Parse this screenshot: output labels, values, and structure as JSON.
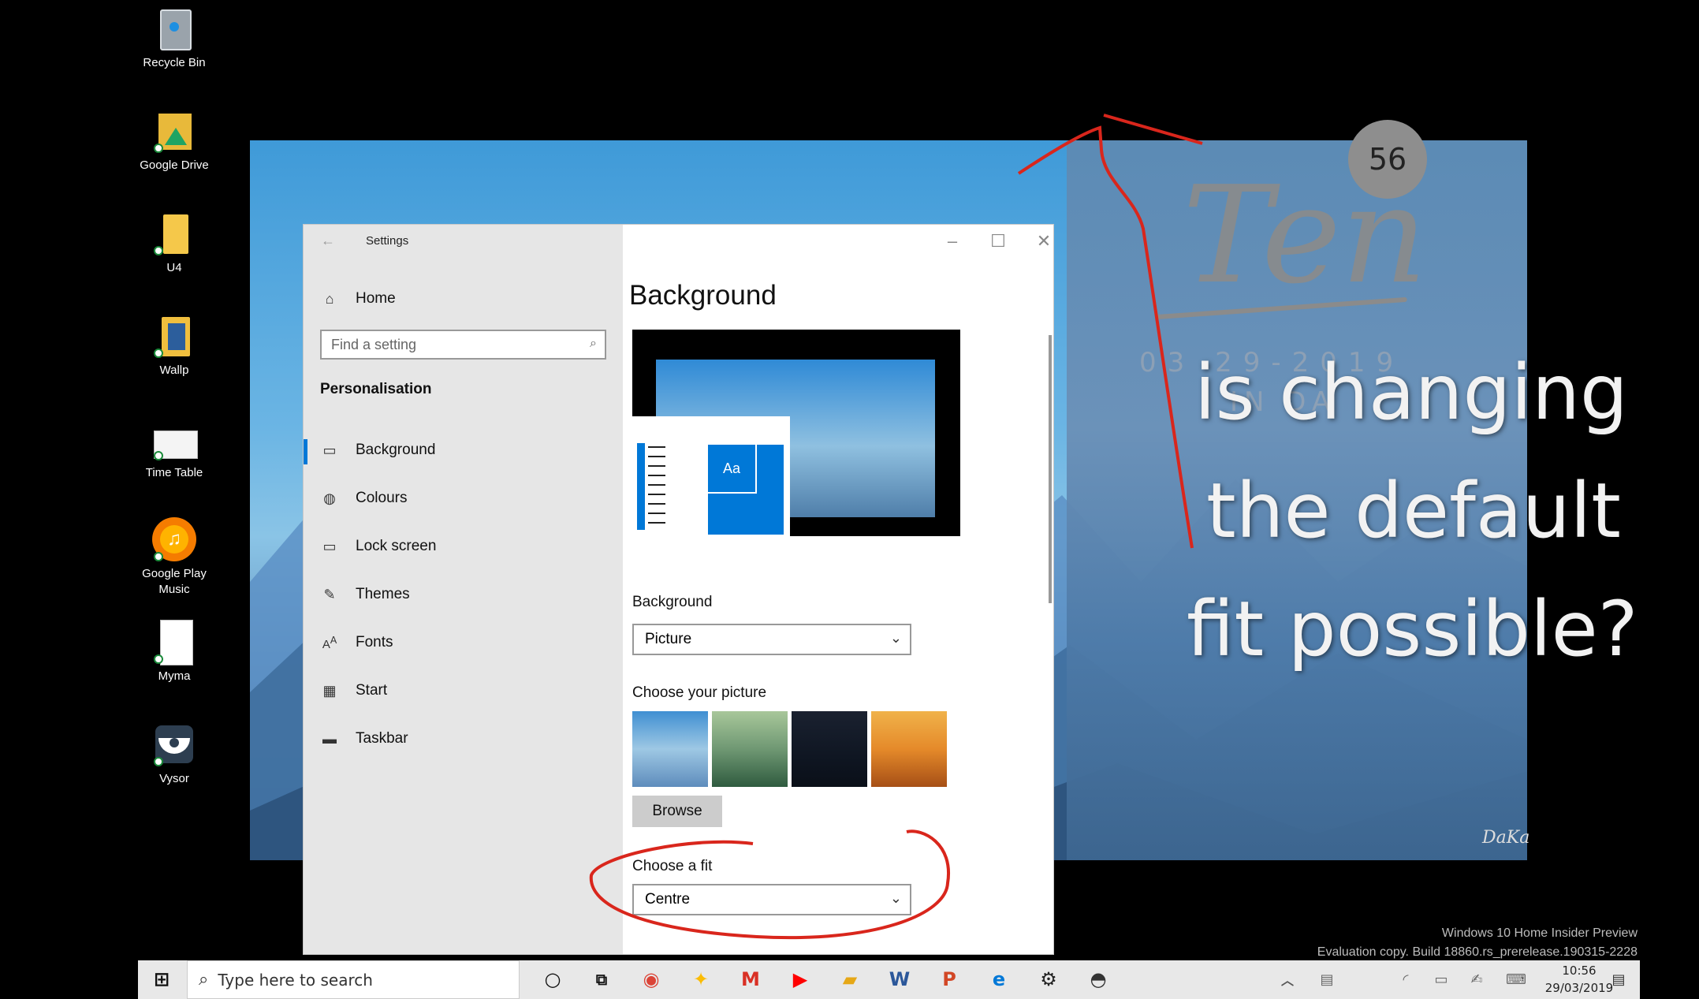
{
  "desktop": {
    "icons": [
      {
        "label": "Recycle Bin"
      },
      {
        "label": "Google Drive"
      },
      {
        "label": "U4"
      },
      {
        "label": "Wallp"
      },
      {
        "label": "Time Table"
      },
      {
        "label": "Google Play Music"
      },
      {
        "label": "Myma"
      },
      {
        "label": "Vysor"
      }
    ]
  },
  "settings": {
    "window_title": "Settings",
    "home_label": "Home",
    "search_placeholder": "Find a setting",
    "section": "Personalisation",
    "nav": [
      {
        "label": "Background",
        "icon": "picture-icon"
      },
      {
        "label": "Colours",
        "icon": "palette-icon"
      },
      {
        "label": "Lock screen",
        "icon": "lock-screen-icon"
      },
      {
        "label": "Themes",
        "icon": "themes-icon"
      },
      {
        "label": "Fonts",
        "icon": "fonts-icon"
      },
      {
        "label": "Start",
        "icon": "start-icon"
      },
      {
        "label": "Taskbar",
        "icon": "taskbar-icon"
      }
    ],
    "page_title": "Background",
    "preview_sample": "Aa",
    "background_label": "Background",
    "background_value": "Picture",
    "choose_picture_label": "Choose your picture",
    "browse_label": "Browse",
    "fit_label": "Choose a fit",
    "fit_value": "Centre"
  },
  "overlay": {
    "badge": "56",
    "logo_text": "Ten",
    "faint_date": "03 29-2019",
    "faint_word": "IN DA",
    "caption_lines": [
      "is changing",
      "the default",
      "fit possible?"
    ],
    "signature": "DaKa"
  },
  "taskbar": {
    "search_placeholder": "Type here to search",
    "watermark_line1": "Windows 10 Home Insider Preview",
    "watermark_line2": "Evaluation copy. Build 18860.rs_prerelease.190315-2228",
    "time": "10:56",
    "date": "29/03/2019"
  },
  "colors": {
    "accent": "#0078d7",
    "annotation": "#d9261c"
  }
}
